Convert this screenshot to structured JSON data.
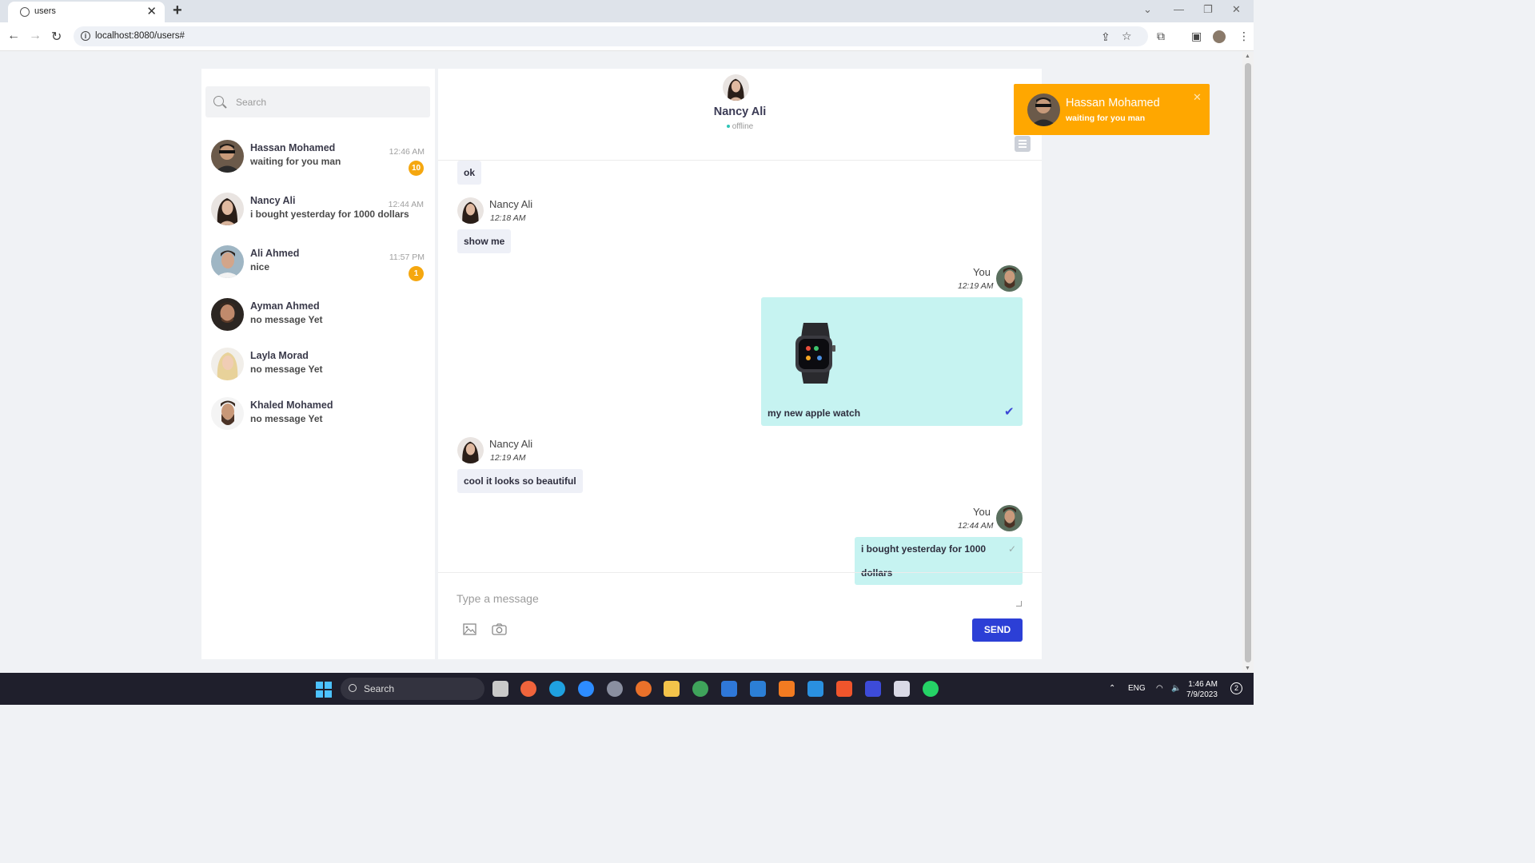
{
  "browser": {
    "tab_title": "users",
    "tab_close": "✕",
    "new_tab": "+",
    "url": "localhost:8080/users#"
  },
  "sidebar": {
    "search_placeholder": "Search",
    "users": [
      {
        "name": "Hassan Mohamed",
        "last_message": "waiting for you man",
        "time": "12:46 AM",
        "badge": "10"
      },
      {
        "name": "Nancy Ali",
        "last_message": "i bought yesterday for 1000 dollars",
        "time": "12:44 AM",
        "badge": ""
      },
      {
        "name": "Ali Ahmed",
        "last_message": "nice",
        "time": "11:57 PM",
        "badge": "1"
      },
      {
        "name": "Ayman Ahmed",
        "last_message": "no message Yet",
        "time": "",
        "badge": ""
      },
      {
        "name": "Layla Morad",
        "last_message": "no message Yet",
        "time": "",
        "badge": ""
      },
      {
        "name": "Khaled Mohamed",
        "last_message": "no message Yet",
        "time": "",
        "badge": ""
      }
    ]
  },
  "chat": {
    "contact_name": "Nancy Ali",
    "status": "offline",
    "messages": [
      {
        "text": "ok"
      },
      {
        "sender": "Nancy Ali",
        "time": "12:18 AM",
        "text": "show me"
      },
      {
        "sender": "You",
        "time": "12:19 AM",
        "caption": "my new apple watch"
      },
      {
        "sender": "Nancy Ali",
        "time": "12:19 AM",
        "text": "cool it looks so beautiful"
      },
      {
        "sender": "You",
        "time": "12:44 AM",
        "text": "i bought yesterday for 1000 dollars"
      }
    ],
    "composer_placeholder": "Type a message",
    "send_label": "SEND"
  },
  "notification": {
    "title": "Hassan Mohamed",
    "message": "waiting for you man",
    "close": "✕"
  },
  "taskbar": {
    "search_label": "Search",
    "language": "ENG",
    "time": "1:46 AM",
    "date": "7/9/2023",
    "notification_count": "2"
  },
  "colors": {
    "accent": "#2c3fd6",
    "notification": "#ffa700",
    "badge": "#f5a70f",
    "outgoing_bubble": "#c6f3f1",
    "incoming_bubble": "#eef0f7"
  }
}
